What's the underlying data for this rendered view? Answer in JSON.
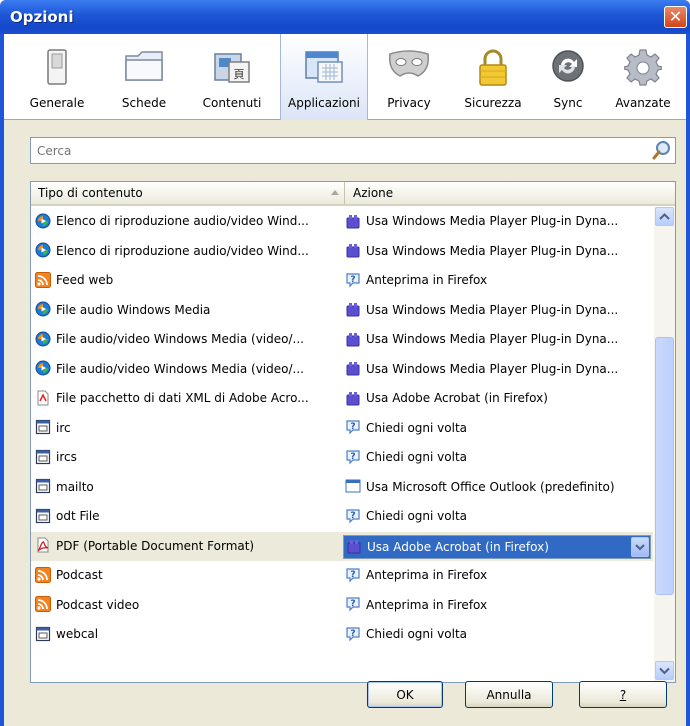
{
  "window": {
    "title": "Opzioni",
    "close_label": "✕"
  },
  "toolbar": {
    "items": [
      {
        "label": "Generale",
        "icon": "switch-icon"
      },
      {
        "label": "Schede",
        "icon": "tabs-icon"
      },
      {
        "label": "Contenuti",
        "icon": "content-icon"
      },
      {
        "label": "Applicazioni",
        "icon": "applications-icon",
        "selected": true
      },
      {
        "label": "Privacy",
        "icon": "mask-icon"
      },
      {
        "label": "Sicurezza",
        "icon": "lock-icon"
      },
      {
        "label": "Sync",
        "icon": "sync-icon"
      },
      {
        "label": "Avanzate",
        "icon": "gear-icon"
      }
    ]
  },
  "search": {
    "placeholder": "Cerca"
  },
  "table": {
    "columns": [
      "Tipo di contenuto",
      "Azione"
    ],
    "rows": [
      {
        "type": "Elenco di riproduzione audio/video Wind...",
        "type_icon": "wmp-icon",
        "action": "Usa Windows Media Player Plug-in Dyna...",
        "action_icon": "plugin-icon"
      },
      {
        "type": "Elenco di riproduzione audio/video Wind...",
        "type_icon": "wmp-icon",
        "action": "Usa Windows Media Player Plug-in Dyna...",
        "action_icon": "plugin-icon"
      },
      {
        "type": "Feed web",
        "type_icon": "feed-icon",
        "action": "Anteprima in Firefox",
        "action_icon": "ask-icon"
      },
      {
        "type": "File audio Windows Media",
        "type_icon": "wmp-icon",
        "action": "Usa Windows Media Player Plug-in Dyna...",
        "action_icon": "plugin-icon"
      },
      {
        "type": "File audio/video Windows Media (video/...",
        "type_icon": "wmp-icon",
        "action": "Usa Windows Media Player Plug-in Dyna...",
        "action_icon": "plugin-icon"
      },
      {
        "type": "File audio/video Windows Media (video/...",
        "type_icon": "wmp-icon",
        "action": "Usa Windows Media Player Plug-in Dyna...",
        "action_icon": "plugin-icon"
      },
      {
        "type": "File pacchetto di dati XML di Adobe Acro...",
        "type_icon": "xml-doc-icon",
        "action": "Usa Adobe Acrobat (in Firefox)",
        "action_icon": "plugin-icon"
      },
      {
        "type": "irc",
        "type_icon": "app-icon",
        "action": "Chiedi ogni volta",
        "action_icon": "ask-icon"
      },
      {
        "type": "ircs",
        "type_icon": "app-icon",
        "action": "Chiedi ogni volta",
        "action_icon": "ask-icon"
      },
      {
        "type": "mailto",
        "type_icon": "app-icon",
        "action": "Usa Microsoft Office Outlook (predefinito)",
        "action_icon": "window-icon"
      },
      {
        "type": "odt File",
        "type_icon": "app-icon",
        "action": "Chiedi ogni volta",
        "action_icon": "ask-icon"
      },
      {
        "type": "PDF (Portable Document Format)",
        "type_icon": "pdf-icon",
        "action": "Usa Adobe Acrobat (in Firefox)",
        "action_icon": "plugin-icon",
        "selected": true
      },
      {
        "type": "Podcast",
        "type_icon": "feed-icon",
        "action": "Anteprima in Firefox",
        "action_icon": "ask-icon"
      },
      {
        "type": "Podcast video",
        "type_icon": "feed-icon",
        "action": "Anteprima in Firefox",
        "action_icon": "ask-icon"
      },
      {
        "type": "webcal",
        "type_icon": "app-icon",
        "action": "Chiedi ogni volta",
        "action_icon": "ask-icon"
      }
    ]
  },
  "buttons": {
    "ok": "OK",
    "cancel": "Annulla",
    "help": "?"
  }
}
